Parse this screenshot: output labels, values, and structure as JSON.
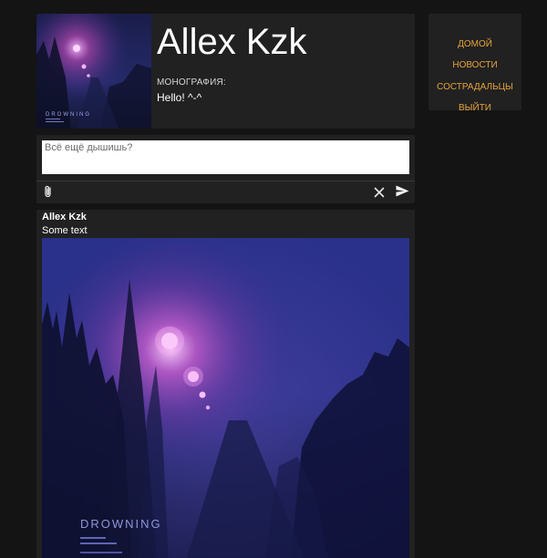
{
  "profile": {
    "name": "Allex Kzk",
    "bio_label": "МОНОГРАФИЯ:",
    "bio_text": "Hello! ^-^",
    "avatar_cover_title": "DROWNING"
  },
  "nav": {
    "items": [
      {
        "label": "ДОМОЙ"
      },
      {
        "label": "НОВОСТИ"
      },
      {
        "label": "СОСТРАДАЛЬЦЫ"
      },
      {
        "label": "ВЫЙТИ"
      }
    ]
  },
  "composer": {
    "placeholder": "Всё ещё дышишь?",
    "value": "",
    "attach_icon": "paperclip-icon",
    "clear_icon": "close-icon",
    "send_icon": "send-icon"
  },
  "post": {
    "author": "Allex Kzk",
    "text": "Some text",
    "image_cover_title": "DROWNING"
  },
  "colors": {
    "background": "#141414",
    "card": "#212121",
    "accent": "#e6a23c",
    "text": "#ffffff"
  }
}
